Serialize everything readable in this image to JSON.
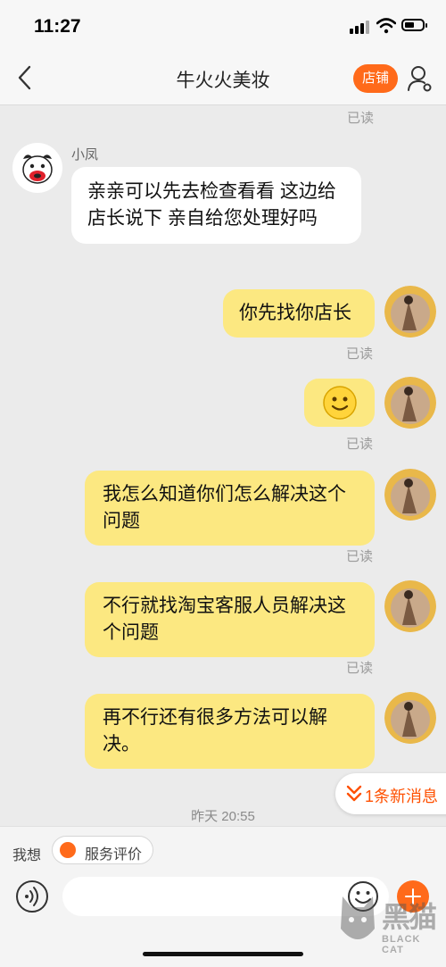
{
  "status_bar": {
    "time": "11:27"
  },
  "header": {
    "title": "牛火火美妆",
    "store_label": "店铺"
  },
  "chat": {
    "read_label": "已读",
    "sender_name": "小凤",
    "incoming": {
      "text": "亲亲可以先去检查看看 这边给店长说下 亲自给您处理好吗"
    },
    "outgoing": [
      {
        "text": "你先找你店长"
      },
      {
        "text": "🙂"
      },
      {
        "text": "我怎么知道你们怎么解决这个问题"
      },
      {
        "text": "不行就找淘宝客服人员解决这个问题"
      },
      {
        "text": "再不行还有很多方法可以解决。"
      }
    ],
    "new_messages": "1条新消息",
    "timestamp": "昨天 20:55"
  },
  "toolbar": {
    "want_label": "我想",
    "service_label": "服务评价",
    "input_placeholder": ""
  },
  "watermark": {
    "cn": "黑猫",
    "en": "BLACK CAT"
  },
  "colors": {
    "accent": "#ff6a1a",
    "bubble_out": "#fce881",
    "bubble_in": "#ffffff",
    "background": "#ebebeb"
  }
}
